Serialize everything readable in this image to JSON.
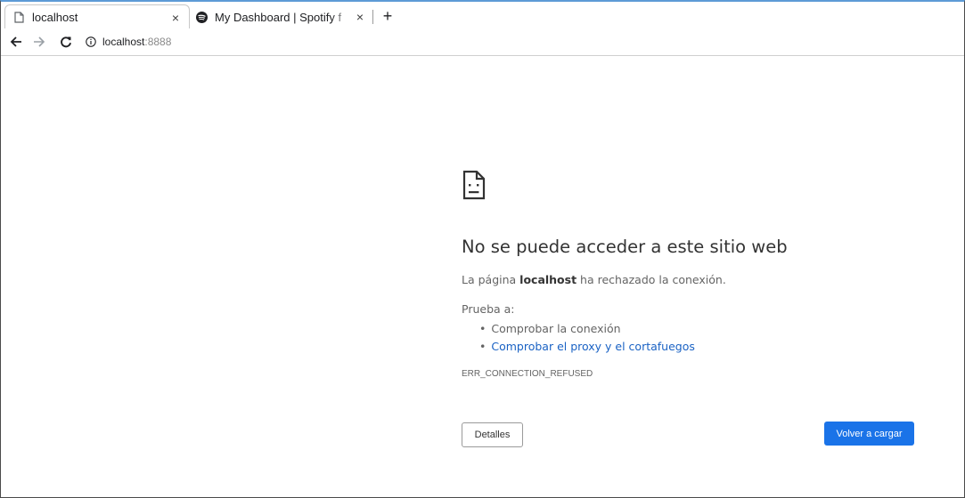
{
  "tabs": [
    {
      "title": "localhost",
      "active": true,
      "favicon": "page-icon"
    },
    {
      "title": "My Dashboard | Spotify f",
      "active": false,
      "favicon": "spotify-icon"
    }
  ],
  "toolbar": {
    "url_host": "localhost",
    "url_port": ":8888"
  },
  "error": {
    "icon": "sad-page-icon",
    "title": "No se puede acceder a este sitio web",
    "desc_prefix": "La página ",
    "desc_host": "localhost",
    "desc_suffix": " ha rechazado la conexión.",
    "suggest_heading": "Prueba a:",
    "suggestions": [
      {
        "text": "Comprobar la conexión",
        "link": false
      },
      {
        "text": "Comprobar el proxy y el cortafuegos",
        "link": true
      }
    ],
    "code": "ERR_CONNECTION_REFUSED",
    "details_button": "Detalles",
    "reload_button": "Volver a cargar"
  },
  "colors": {
    "accent": "#1a73e8",
    "link": "#1a62c4"
  }
}
